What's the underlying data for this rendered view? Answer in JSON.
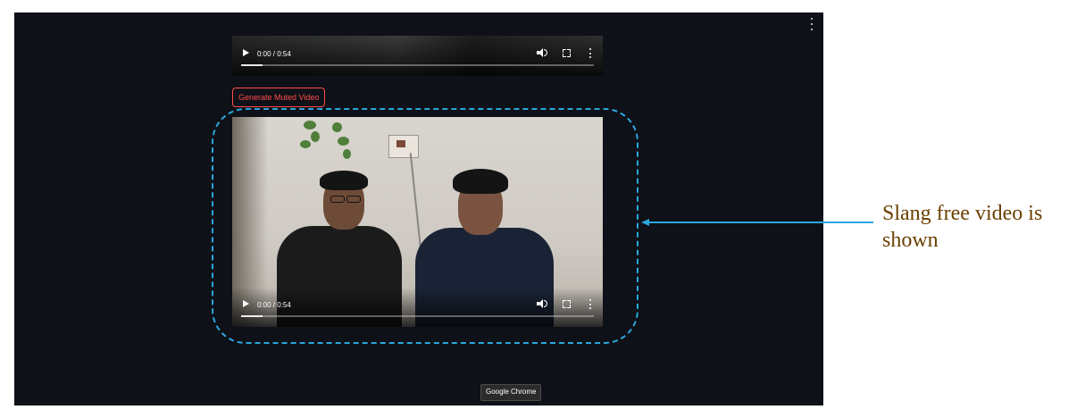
{
  "app": {
    "background": "#0e1117",
    "menu_icon": "more-vert-icon"
  },
  "videos": [
    {
      "time": "0:00 / 0:54",
      "progress": 0
    },
    {
      "time": "0:00 / 0:54",
      "progress": 0
    }
  ],
  "actions": {
    "generate_muted_label": "Generate Muted Video",
    "button_color": "#ff4b4b"
  },
  "tooltip": {
    "text": "Google Chrome"
  },
  "annotation": {
    "text": "Slang free video is shown",
    "text_color": "#6b3f00",
    "highlight_color": "#2aa7df"
  }
}
